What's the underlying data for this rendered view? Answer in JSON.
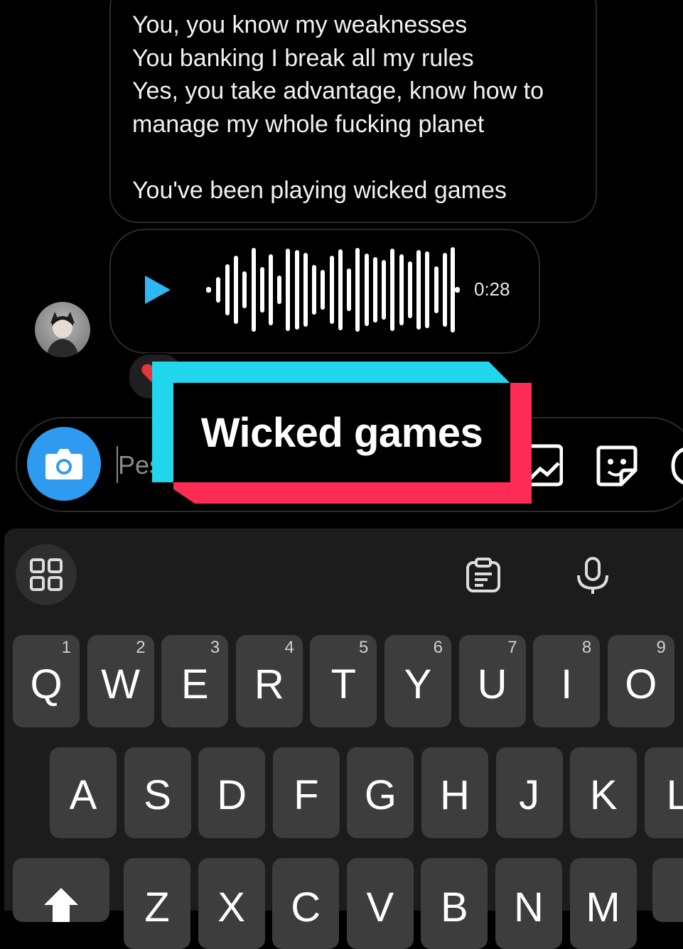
{
  "chat": {
    "lyrics": "You, you know my weaknesses\nYou banking I break all my rules\nYes, you take advantage, know how to\nmanage my whole fucking planet\n\nYou've been playing wicked games",
    "audio_duration": "0:28",
    "reaction_emoji": "❤️"
  },
  "composer": {
    "placeholder_visible": "Pes"
  },
  "caption": {
    "text": "Wicked games",
    "colors": {
      "cyan": "#20d5ec",
      "red": "#fe2c55"
    }
  },
  "keyboard": {
    "row1": [
      {
        "ch": "Q",
        "num": "1"
      },
      {
        "ch": "W",
        "num": "2"
      },
      {
        "ch": "E",
        "num": "3"
      },
      {
        "ch": "R",
        "num": "4"
      },
      {
        "ch": "T",
        "num": "5"
      },
      {
        "ch": "Y",
        "num": "6"
      },
      {
        "ch": "U",
        "num": "7"
      },
      {
        "ch": "I",
        "num": "8"
      },
      {
        "ch": "O",
        "num": "9"
      }
    ],
    "row2": [
      "A",
      "S",
      "D",
      "F",
      "G",
      "H",
      "J",
      "K",
      "L"
    ],
    "row3": [
      "Z",
      "X",
      "C",
      "V",
      "B",
      "N",
      "M"
    ]
  },
  "colors": {
    "accent_blue": "#2f9bf0",
    "play_blue": "#2fb7f5"
  }
}
